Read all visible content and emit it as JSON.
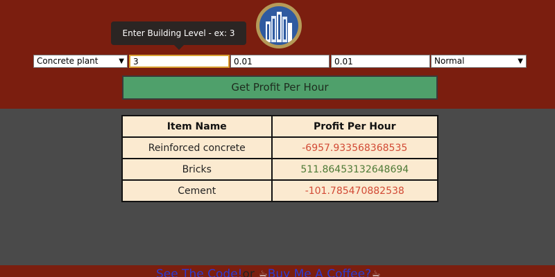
{
  "colors": {
    "header_bg": "#7b1e0f",
    "body_bg": "#4a4a4a",
    "button_bg": "#4fa06b",
    "table_bg": "#fbead0",
    "negative": "#d24a35",
    "positive": "#4d7a36"
  },
  "logo": {
    "icon": "city-buildings-icon"
  },
  "tooltip": {
    "text": "Enter Building Level - ex: 3"
  },
  "controls": {
    "building_select": "Concrete plant",
    "level_input": "3",
    "field2_input": "0.01",
    "field3_input": "0.01",
    "mode_select": "Normal"
  },
  "profit_button": {
    "label": "Get Profit Per Hour"
  },
  "table": {
    "headers": [
      "Item Name",
      "Profit Per Hour"
    ],
    "rows": [
      {
        "name": "Reinforced concrete",
        "profit": "-6957.933568368535",
        "sign": "neg"
      },
      {
        "name": "Bricks",
        "profit": "511.86453132648694",
        "sign": "pos"
      },
      {
        "name": "Cement",
        "profit": "-101.785470882538",
        "sign": "neg"
      }
    ]
  },
  "footer": {
    "code_link": "See The Code!",
    "separator": "or",
    "coffee_cup_icon": "coffee-cup-icon",
    "coffee_link": "Buy Me A Coffee?"
  }
}
